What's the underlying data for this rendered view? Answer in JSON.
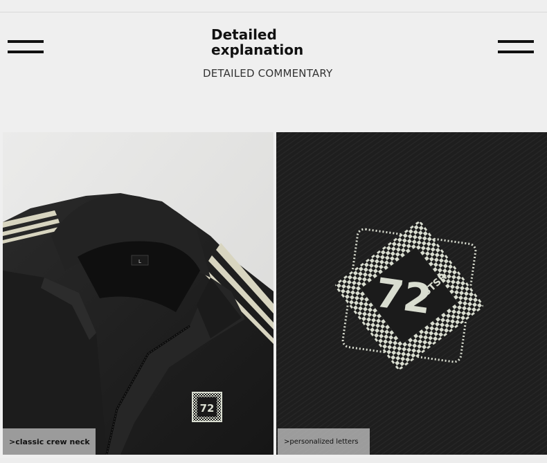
{
  "header": {
    "title": "Detailed explanation",
    "subtitle": "DETAILED COMMENTARY"
  },
  "icons": {
    "menu_left": "menu-icon",
    "menu_right": "menu-icon"
  },
  "panels": [
    {
      "caption": ">classic crew neck"
    },
    {
      "caption": ">personalized letters"
    }
  ],
  "labels": {
    "neck_tag": "L",
    "badge_number": "72",
    "badge_letters": "STSR"
  },
  "colors": {
    "fabric": "#1e1e1e",
    "stripe": "#d8d5c0",
    "badge": "#d9ddd0"
  }
}
